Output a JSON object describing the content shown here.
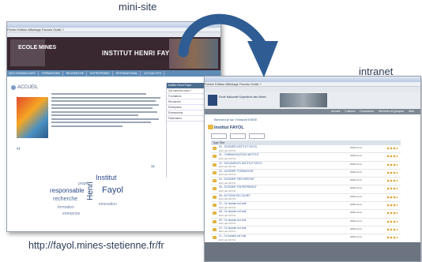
{
  "captions": {
    "mini_site": "mini-site",
    "intranet": "intranet",
    "url": "http://fayol.mines-stetienne.fr/fr"
  },
  "mini_site": {
    "menu": "Fichier  Edition  Affichage  Favoris  Outils  ?",
    "logo": "ECOLE MINES",
    "banner_title": "INSTITUT HENRI FAYOL",
    "nav": [
      "NOS GRANDS AXES",
      "FORMATIONS",
      "RECHERCHE",
      "ENTREPRISES",
      "INTERNATIONAL",
      "ACTUALITES"
    ],
    "accueil": "ACCUEIL",
    "quote_open": "“",
    "quote_close": "”",
    "side_heading": "Institut Henri Fayol",
    "side_items": [
      "Qui sommes-nous ?",
      "Formations",
      "Recherche",
      "Entreprises",
      "Evenements",
      "Partenaires"
    ],
    "cloud_words": [
      "Institut",
      "Henri",
      "responsable",
      "recherche",
      "Fayol",
      "formation",
      "innovation",
      "entreprise",
      "projet"
    ]
  },
  "intranet": {
    "menu": "Fichier  Edition  Affichage  Favoris  Outils  ?",
    "logo_text": "Ecole Nationale Supérieure des Mines",
    "nav": [
      "Accueil",
      "Cultures",
      "Documents",
      "Membres et groupes",
      "Aide"
    ],
    "breadcrumb": "Bienvenue sur l'Intranet EMSE",
    "title": "Institut FAYOL",
    "list_header": "Type  Titre",
    "rows": [
      {
        "title": "00 - DOSSIER INSTITUT FAYOL",
        "sub": "Ecrit par FAYOL",
        "date": "2009-12-11"
      },
      {
        "title": "01 - COMMUNICATION INSTITUT",
        "sub": "Ecrit par FAYOL",
        "date": "2009-12-11"
      },
      {
        "title": "02 - DOCUMENTS INSTITUT FAYOL",
        "sub": "Ecrit par FAYOL",
        "date": "2009-12-11"
      },
      {
        "title": "03 - DOSSIER \"FORMATION\"",
        "sub": "Ecrit par FAYOL",
        "date": "2009-12-11"
      },
      {
        "title": "04 - DOSSIER \"RECHERCHE\"",
        "sub": "Ecrit par FAYOL",
        "date": "2009-12-11"
      },
      {
        "title": "05 - DOSSIER \"ENTREPRISES\"",
        "sub": "Ecrit par FAYOL",
        "date": "2009-12-11"
      },
      {
        "title": "06 - ACTIONS EN COURS",
        "sub": "Ecrit par FAYOL",
        "date": "2009-12-11"
      },
      {
        "title": "07 - Ce dossier est vide",
        "sub": "Ecrit par FAYOL",
        "date": "2009-12-11"
      },
      {
        "title": "08 - Ce dossier est vide",
        "sub": "Ecrit par FAYOL",
        "date": "2009-12-11"
      },
      {
        "title": "09 - Ce dossier est vide",
        "sub": "Ecrit par FAYOL",
        "date": "2009-12-11"
      },
      {
        "title": "10 - Ce dossier est vide",
        "sub": "Ecrit par FAYOL",
        "date": "2009-12-11"
      },
      {
        "title": "11 - Ce dossier est vide",
        "sub": "Ecrit par FAYOL",
        "date": "2009-12-11"
      }
    ]
  },
  "colors": {
    "arrow": "#2f5d93",
    "mini_banner": "#3a2830",
    "mini_nav": "#5e8db8",
    "intranet_nav": "#7d8794"
  }
}
